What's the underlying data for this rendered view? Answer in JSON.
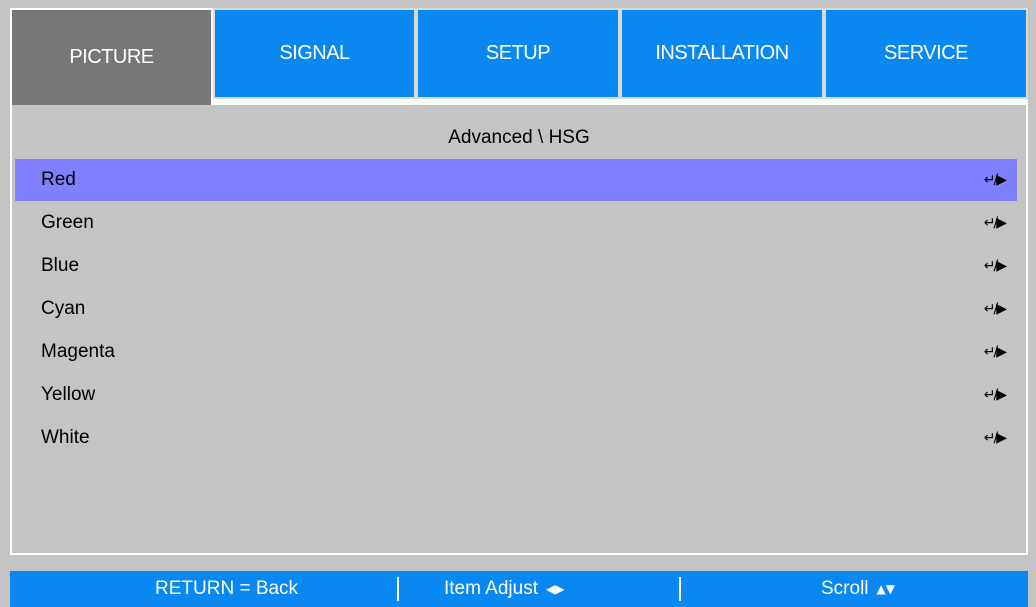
{
  "tabs": [
    {
      "label": "PICTURE",
      "active": true
    },
    {
      "label": "SIGNAL",
      "active": false
    },
    {
      "label": "SETUP",
      "active": false
    },
    {
      "label": "INSTALLATION",
      "active": false
    },
    {
      "label": "SERVICE",
      "active": false
    }
  ],
  "breadcrumb": "Advanced \\ HSG",
  "items": [
    {
      "label": "Red",
      "selected": true,
      "action_icon": "enter-or-right-icon"
    },
    {
      "label": "Green",
      "selected": false,
      "action_icon": "enter-or-right-icon"
    },
    {
      "label": "Blue",
      "selected": false,
      "action_icon": "enter-or-right-icon"
    },
    {
      "label": "Cyan",
      "selected": false,
      "action_icon": "enter-or-right-icon"
    },
    {
      "label": "Magenta",
      "selected": false,
      "action_icon": "enter-or-right-icon"
    },
    {
      "label": "Yellow",
      "selected": false,
      "action_icon": "enter-or-right-icon"
    },
    {
      "label": "White",
      "selected": false,
      "action_icon": "enter-or-right-icon"
    }
  ],
  "footer": {
    "return_hint": "RETURN = Back",
    "adjust_hint": "Item Adjust",
    "scroll_hint": "Scroll"
  },
  "colors": {
    "tab_blue": "#0a88f2",
    "tab_active": "#777777",
    "panel_gray": "#c4c4c4",
    "selection": "#8080ff"
  }
}
